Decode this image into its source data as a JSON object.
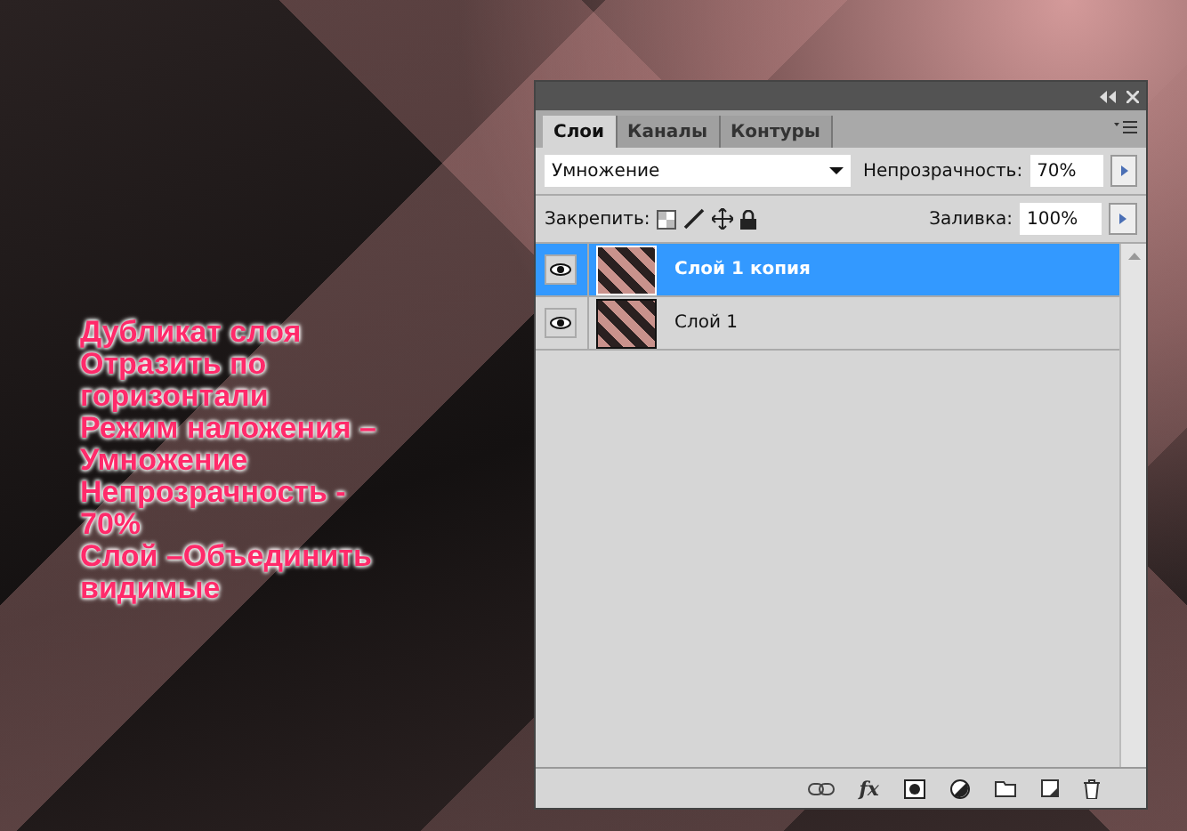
{
  "overlay_text": [
    "Дубликат слоя",
    "Отразить по",
    "горизонтали",
    "Режим наложения –",
    "Умножение",
    "Непрозрачность -",
    "70%",
    "Слой –Объединить",
    "видимые"
  ],
  "panel": {
    "tabs": [
      {
        "label": "Слои",
        "selected": true
      },
      {
        "label": "Каналы",
        "selected": false
      },
      {
        "label": "Контуры",
        "selected": false
      }
    ],
    "blend_mode": "Умножение",
    "opacity_label": "Непрозрачность:",
    "opacity": "70%",
    "lock_label": "Закрепить:",
    "fill_label": "Заливка:",
    "fill": "100%",
    "layers": [
      {
        "name": "Слой 1 копия",
        "visible": true,
        "selected": true
      },
      {
        "name": "Слой 1",
        "visible": true,
        "selected": false
      }
    ],
    "footer_fx": "fx"
  }
}
